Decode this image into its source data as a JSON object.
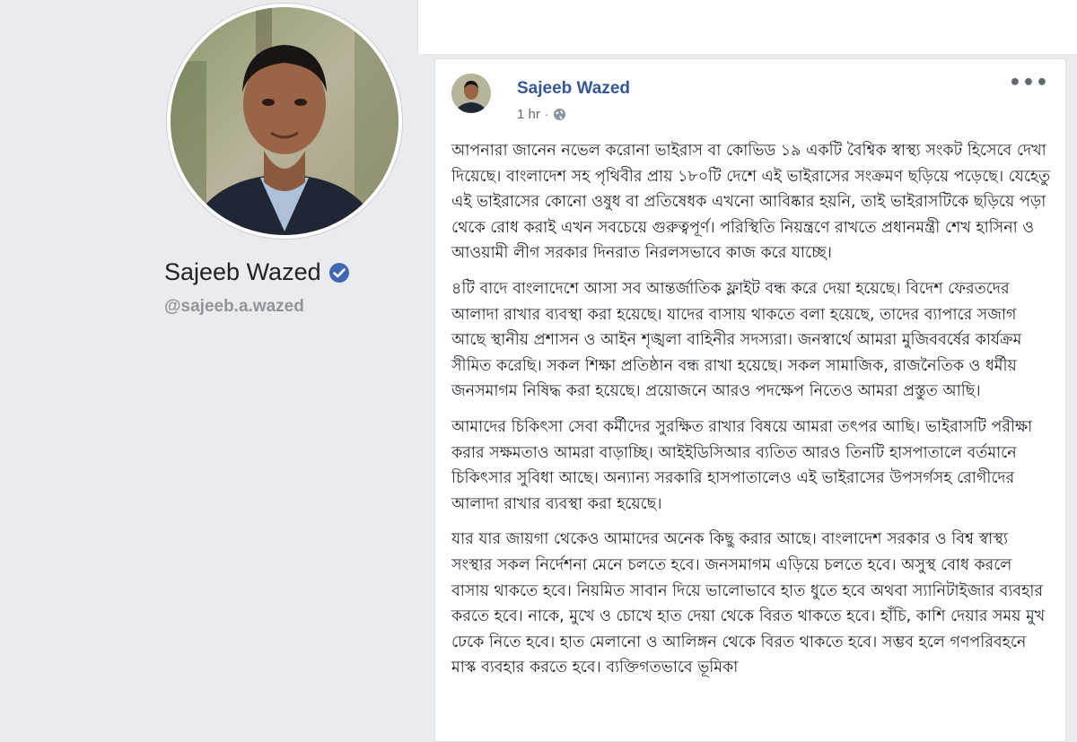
{
  "profile": {
    "name": "Sajeeb Wazed",
    "handle": "@sajeeb.a.wazed",
    "verified_icon": "verified-badge-icon",
    "verified_color": "#4267b2"
  },
  "post": {
    "author": "Sajeeb Wazed",
    "time": "1 hr",
    "separator": "·",
    "privacy_icon": "globe-icon",
    "more_icon": "more-options-icon",
    "more_glyph": "•••",
    "paragraphs": [
      "আপনারা জানেন নভেল করোনা ভাইরাস বা কোভিড ১৯ একটি বৈশ্বিক স্বাস্থ্য সংকট হিসেবে দেখা দিয়েছে। বাংলাদেশ সহ পৃথিবীর প্রায় ১৮০টি দেশে এই ভাইরাসের সংক্রমণ ছড়িয়ে পড়েছে। যেহেতু এই ভাইরাসের কোনো ওষুধ বা প্রতিষেধক এখনো আবিষ্কার হয়নি, তাই ভাইরাসটিকে ছড়িয়ে পড়া থেকে রোধ করাই এখন সবচেয়ে গুরুত্বপূর্ণ। পরিস্থিতি নিয়ন্ত্রণে রাখতে প্রধানমন্ত্রী শেখ হাসিনা ও আওয়ামী লীগ সরকার দিনরাত নিরলসভাবে কাজ করে যাচ্ছে।",
      "৪টি বাদে বাংলাদেশে আসা সব আন্তর্জাতিক ফ্লাইট বন্ধ করে দেয়া হয়েছে। বিদেশ ফেরতদের আলাদা রাখার ব্যবস্থা করা হয়েছে। যাদের বাসায় থাকতে বলা হয়েছে, তাদের ব্যাপারে সজাগ আছে স্থানীয় প্রশাসন ও আইন শৃঙ্খলা বাহিনীর সদস্যরা। জনস্বার্থে আমরা মুজিববর্ষের কার্যক্রম সীমিত করেছি। সকল শিক্ষা প্রতিষ্ঠান বন্ধ রাখা হয়েছে। সকল সামাজিক, রাজনৈতিক ও ধর্মীয় জনসমাগম নিষিদ্ধ করা হয়েছে। প্রয়োজনে আরও পদক্ষেপ নিতেও আমরা প্রস্তুত আছি।",
      "আমাদের চিকিৎসা সেবা কর্মীদের সুরক্ষিত রাখার বিষয়ে আমরা তৎপর আছি। ভাইরাসটি পরীক্ষা করার সক্ষমতাও আমরা বাড়াচ্ছি। আইইডিসিআর ব্যতিত আরও তিনটি হাসপাতালে বর্তমানে চিকিৎসার সুবিধা আছে। অন্যান্য সরকারি হাসপাতালেও এই ভাইরাসের উপসর্গসহ রোগীদের আলাদা রাখার ব্যবস্থা করা হয়েছে।",
      "যার যার জায়গা থেকেও আমাদের অনেক কিছু করার আছে। বাংলাদেশ সরকার ও বিশ্ব স্বাস্থ্য সংস্থার সকল নির্দেশনা মেনে চলতে হবে। জনসমাগম এড়িয়ে চলতে হবে। অসুস্থ বোধ করলে বাসায় থাকতে হবে। নিয়মিত সাবান দিয়ে ভালোভাবে হাত ধুতে হবে অথবা স্যানিটাইজার ব্যবহার করতে হবে। নাকে, মুখে ও চোখে হাত দেয়া থেকে বিরত থাকতে হবে। হাঁচি, কাশি দেয়ার সময় মুখ ঢেকে নিতে হবে। হাত মেলানো ও আলিঙ্গন থেকে বিরত থাকতে হবে। সম্ভব হলে গণপরিবহনে মাস্ক ব্যবহার করতে হবে। ব্যক্তিগতভাবে ভূমিকা"
    ]
  },
  "colors": {
    "page_bg": "#e9ebee",
    "card_bg": "#ffffff",
    "link": "#365899",
    "text": "#1d2129",
    "muted": "#90949c"
  }
}
